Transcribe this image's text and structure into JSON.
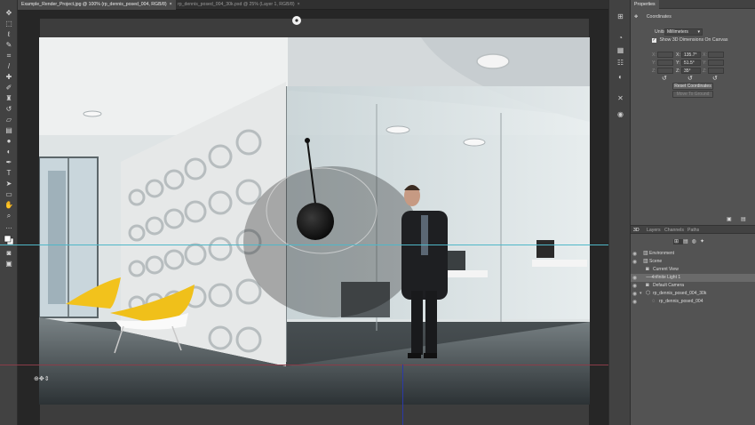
{
  "document_tabs": [
    {
      "label": "Example_Render_Project.jpg @ 100% (rp_dennis_posed_004, RGB/8)",
      "close": "×",
      "active": true
    },
    {
      "label": "rp_dennis_posed_004_30k.psd @ 25% (Layer 1, RGB/8)",
      "close": "×",
      "active": false
    }
  ],
  "properties": {
    "tab": "Properties",
    "section_title": "Coordinates",
    "units_label": "Units:",
    "units_value": "Millimeters",
    "show_3d_label": "Show 3D Dimensions On Canvas",
    "x_label": "X:",
    "y_label": "Y:",
    "z_label": "Z:",
    "rx_value": "135.7°",
    "ry_value": "51.5°",
    "rz_value": "35°",
    "reset_button": "Reset Coordinates",
    "move_button": "Move To Ground"
  },
  "panel_tabs": {
    "tab_3d": "3D",
    "tab_layers": "Layers",
    "tab_channels": "Channels",
    "tab_paths": "Paths"
  },
  "layers": [
    {
      "label": "Environment"
    },
    {
      "label": "Scene"
    },
    {
      "label": "Current View"
    },
    {
      "label": "Infinite Light 1"
    },
    {
      "label": "Default Camera"
    },
    {
      "label": "rp_dennis_posed_004_30k"
    },
    {
      "label": "rp_dennis_posed_004"
    }
  ],
  "colors": {
    "accent_cyan_guide": "#4fb7c8",
    "ground_red_guide": "#8a3c48",
    "panel_bg": "#535353",
    "workspace_bg": "#262626"
  },
  "icons": {
    "tools": [
      "move-icon",
      "marquee-icon",
      "lasso-icon",
      "quick-select-icon",
      "crop-icon",
      "eyedropper-icon",
      "healing-icon",
      "brush-icon",
      "stamp-icon",
      "history-brush-icon",
      "eraser-icon",
      "gradient-icon",
      "blur-icon",
      "dodge-icon",
      "pen-icon",
      "type-icon",
      "path-select-icon",
      "shape-icon",
      "hand-icon",
      "zoom-icon",
      "more-tools-icon",
      "color-swatch-icon",
      "quick-mask-icon",
      "screen-mode-icon"
    ]
  }
}
